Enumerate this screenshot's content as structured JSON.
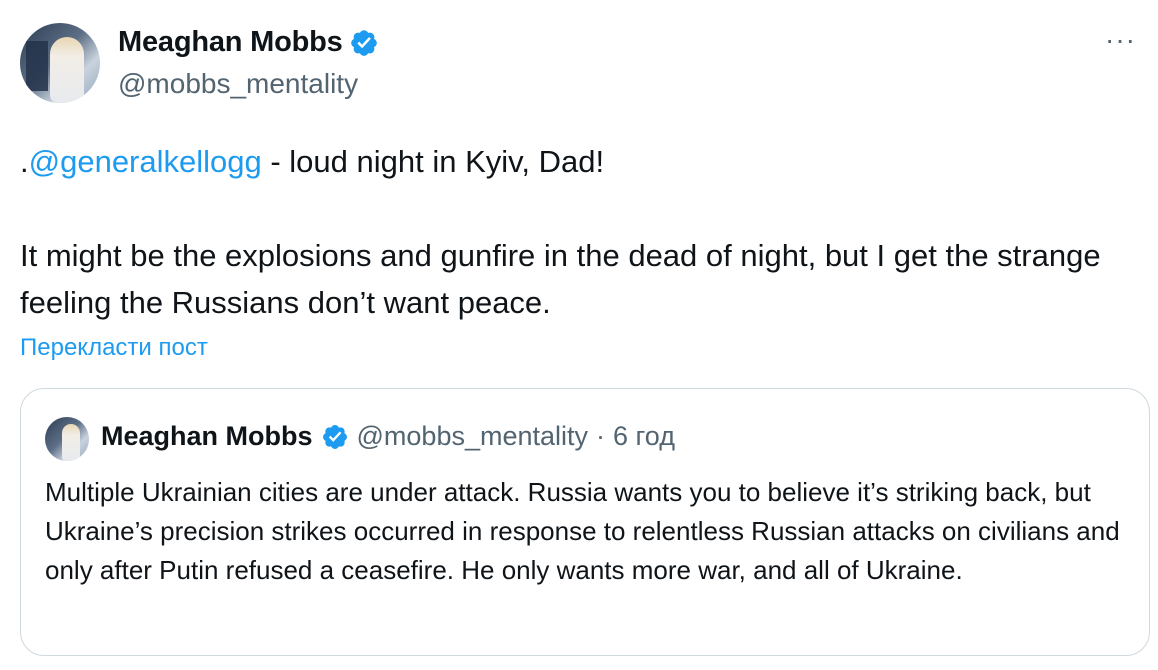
{
  "author": {
    "display_name": "Meaghan Mobbs",
    "handle": "@mobbs_mentality",
    "verified": true
  },
  "menu": {
    "more_label": "···"
  },
  "tweet": {
    "prefix": ".",
    "mention": "@generalkellogg",
    "line1_rest": " - loud night in Kyiv, Dad!",
    "paragraph2": "It might be the explosions and gunfire in the dead of night, but I get the strange feeling the Russians don’t want peace."
  },
  "translate_label": "Перекласти пост",
  "quoted": {
    "display_name": "Meaghan Mobbs",
    "handle": "@mobbs_mentality",
    "separator": "·",
    "time": "6 год",
    "text": "Multiple Ukrainian cities are under attack. Russia wants you to believe it’s striking back, but Ukraine’s precision strikes occurred in response to relentless Russian attacks on civilians and only after Putin refused a ceasefire. He only wants more war, and all of Ukraine."
  },
  "colors": {
    "link": "#1d9bf0",
    "secondary_text": "#536471",
    "primary_text": "#0f1419",
    "border": "#cfd9de"
  },
  "icons": {
    "verified": "verified-badge-icon",
    "more": "more-horizontal-icon"
  }
}
